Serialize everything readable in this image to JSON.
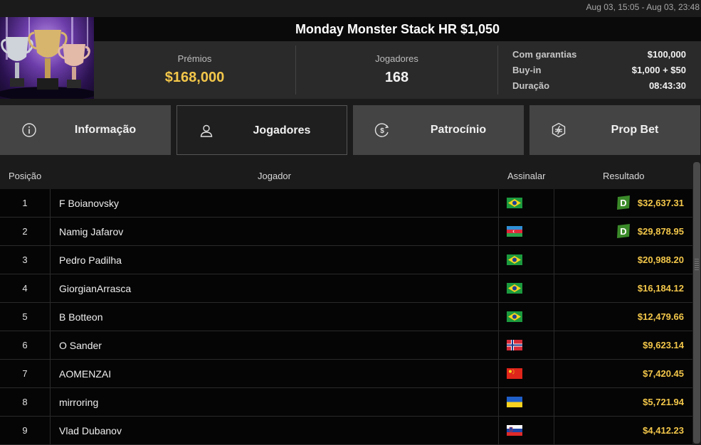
{
  "date_range": "Aug 03, 15:05 - Aug 03, 23:48",
  "tournament": {
    "title": "Monday Monster Stack HR $1,050",
    "prizes_label": "Prémios",
    "prizes_value": "$168,000",
    "players_label": "Jogadores",
    "players_value": "168",
    "guaranteed_label": "Com garantias",
    "guaranteed_value": "$100,000",
    "buyin_label": "Buy-in",
    "buyin_value": "$1,000 + $50",
    "duration_label": "Duração",
    "duration_value": "08:43:30"
  },
  "tabs": [
    {
      "label": "Informação",
      "icon": "info-icon",
      "active": false
    },
    {
      "label": "Jogadores",
      "icon": "user-icon",
      "active": true
    },
    {
      "label": "Patrocínio",
      "icon": "dollar-coin-icon",
      "active": false
    },
    {
      "label": "Prop Bet",
      "icon": "prop-bet-icon",
      "active": false
    }
  ],
  "table": {
    "headers": {
      "position": "Posição",
      "player": "Jogador",
      "flag": "Assinalar",
      "result": "Resultado"
    },
    "rows": [
      {
        "position": "1",
        "player": "F Boianovsky",
        "flag": "brazil",
        "result": "$32,637.31",
        "badge": "D"
      },
      {
        "position": "2",
        "player": "Namig Jafarov",
        "flag": "azerbaijan",
        "result": "$29,878.95",
        "badge": "D"
      },
      {
        "position": "3",
        "player": "Pedro Padilha",
        "flag": "brazil",
        "result": "$20,988.20",
        "badge": ""
      },
      {
        "position": "4",
        "player": "GiorgianArrasca",
        "flag": "brazil",
        "result": "$16,184.12",
        "badge": ""
      },
      {
        "position": "5",
        "player": "B Botteon",
        "flag": "brazil",
        "result": "$12,479.66",
        "badge": ""
      },
      {
        "position": "6",
        "player": "O Sander",
        "flag": "norway",
        "result": "$9,623.14",
        "badge": ""
      },
      {
        "position": "7",
        "player": "AOMENZAI",
        "flag": "china",
        "result": "$7,420.45",
        "badge": ""
      },
      {
        "position": "8",
        "player": "mirroring",
        "flag": "ukraine",
        "result": "$5,721.94",
        "badge": ""
      },
      {
        "position": "9",
        "player": "Vlad Dubanov",
        "flag": "slovenia",
        "result": "$4,412.23",
        "badge": ""
      }
    ]
  },
  "colors": {
    "gold": "#f3c74a",
    "badge_green": "#3b8a2a"
  }
}
